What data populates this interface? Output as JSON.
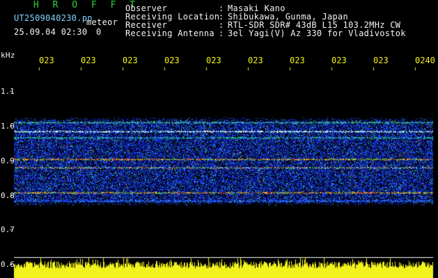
{
  "header": {
    "title": "H R O F F T",
    "filename": "UT2509040230.pn",
    "mode": "meteor",
    "timestamp": "25.09.04 02:30",
    "counter": "0"
  },
  "meta": [
    {
      "label": "Observer",
      "value": "Masaki Kano"
    },
    {
      "label": "Receiving Location",
      "value": "Shibukawa, Gunma, Japan"
    },
    {
      "label": "Receiver",
      "value": "RTL-SDR SDR# 43dB L15 103.2MHz CW"
    },
    {
      "label": "Receiving Antenna",
      "value": "3el Yagi(V) Az 330 for Vladivostok"
    }
  ],
  "axis": {
    "unit": "kHz",
    "y_labels": [
      "1.1",
      "1.0",
      "0.9",
      "0.8",
      "0.7",
      "0.6"
    ],
    "x_labels": [
      "023",
      "023",
      "023",
      "023",
      "023",
      "023",
      "023",
      "023",
      "023",
      "0240"
    ]
  },
  "colors": {
    "background": "#000000",
    "title": "#2fd23f",
    "axis_ticks": "#f2f21c",
    "signal_strong": "#ff2a2a",
    "signal_mid": "#22cc55",
    "signal_low": "#1a3cff",
    "noise_floor": "#f2f21c"
  }
}
